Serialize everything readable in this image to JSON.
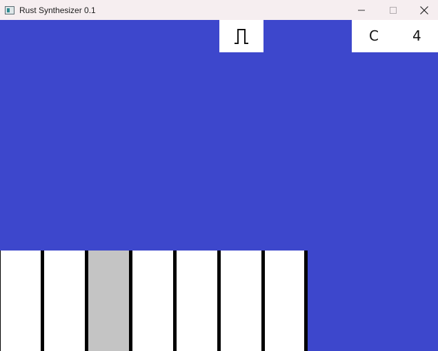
{
  "window": {
    "title": "Rust Synthesizer 0.1"
  },
  "waveform": {
    "icon": "square-wave-icon"
  },
  "note": {
    "name": "C",
    "octave": "4"
  },
  "keyboard": {
    "key_count": 7,
    "pressed_index": 2
  },
  "colors": {
    "background": "#3d47cc",
    "titlebar": "#f6eef0",
    "key_white": "#ffffff",
    "key_pressed": "#c4c4c4",
    "key_border": "#000000"
  }
}
